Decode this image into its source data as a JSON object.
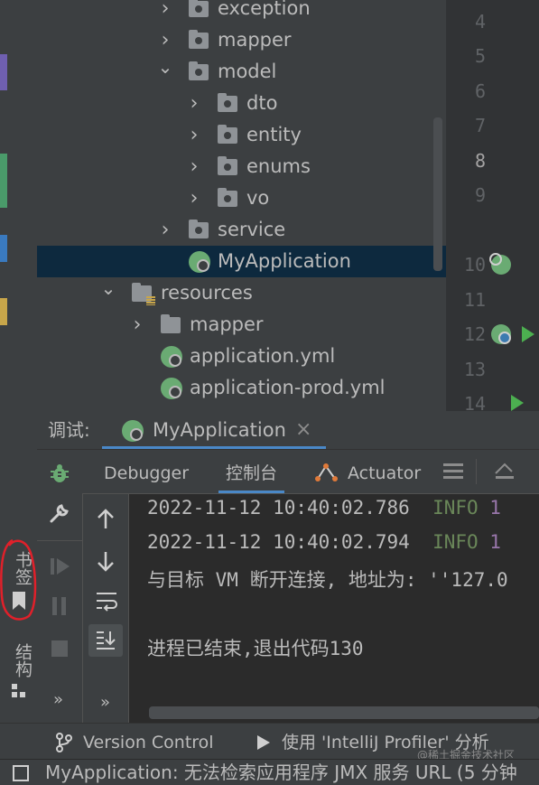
{
  "project_tree": {
    "items": [
      {
        "label": "exception",
        "type": "folder",
        "level": 2,
        "chevron": "›",
        "selected": false
      },
      {
        "label": "mapper",
        "type": "folder",
        "level": 2,
        "chevron": "›",
        "selected": false
      },
      {
        "label": "model",
        "type": "folder",
        "level": 2,
        "chevron": "⌄",
        "selected": false
      },
      {
        "label": "dto",
        "type": "folder",
        "level": 3,
        "chevron": "›",
        "selected": false
      },
      {
        "label": "entity",
        "type": "folder",
        "level": 3,
        "chevron": "›",
        "selected": false
      },
      {
        "label": "enums",
        "type": "folder",
        "level": 3,
        "chevron": "›",
        "selected": false
      },
      {
        "label": "vo",
        "type": "folder",
        "level": 3,
        "chevron": "›",
        "selected": false
      },
      {
        "label": "service",
        "type": "folder",
        "level": 2,
        "chevron": "›",
        "selected": false
      },
      {
        "label": "MyApplication",
        "type": "spring-class",
        "level": 2,
        "chevron": "",
        "selected": true
      },
      {
        "label": "resources",
        "type": "resources-folder",
        "level": 0,
        "chevron": "⌄",
        "selected": false
      },
      {
        "label": "mapper",
        "type": "folder",
        "level": 1,
        "chevron": "›",
        "selected": false
      },
      {
        "label": "application.yml",
        "type": "spring-config",
        "level": 1,
        "chevron": "",
        "selected": false
      },
      {
        "label": "application-prod.yml",
        "type": "spring-config",
        "level": 1,
        "chevron": "",
        "selected": false
      }
    ]
  },
  "editor_gutter": {
    "lines": [
      "4",
      "5",
      "6",
      "7",
      "8",
      "9",
      "10",
      "11",
      "12",
      "13",
      "14"
    ],
    "current_line": "8"
  },
  "left_toolbar": {
    "bookmarks_label": "书签",
    "structure_label": "结构"
  },
  "debug_panel": {
    "title": "调试:",
    "run_tab_label": "MyApplication",
    "close_symbol": "×",
    "tabs": [
      {
        "label": "Debugger",
        "active": false
      },
      {
        "label": "控制台",
        "active": true
      },
      {
        "label": "Actuator",
        "active": false
      }
    ],
    "more_symbol": "»"
  },
  "console": {
    "lines": [
      {
        "text": "2022-11-12 10:40:02.786  ",
        "level": "INFO",
        "tail": " 1"
      },
      {
        "text": "2022-11-12 10:40:02.794  ",
        "level": "INFO",
        "tail": " 1"
      },
      {
        "text": "与目标 VM 断开连接, 地址为: ''127.0",
        "level": "",
        "tail": ""
      },
      {
        "text": "",
        "level": "",
        "tail": ""
      },
      {
        "text": "进程已结束,退出代码130",
        "level": "",
        "tail": ""
      }
    ]
  },
  "bottom_bar": {
    "version_control": "Version Control",
    "profiler": "使用 'IntelliJ Profiler' 分析",
    "watermark": "@稀土掘金技术社区"
  },
  "status_bar": {
    "message": "MyApplication: 无法检索应用程序 JMX 服务 URL (5 分钟"
  },
  "colors": {
    "selection": "#0d293e",
    "spring_green": "#6aab73",
    "info_green": "#6a8759",
    "accent_blue": "#4a88c7",
    "annotation_red": "#e0202a"
  }
}
